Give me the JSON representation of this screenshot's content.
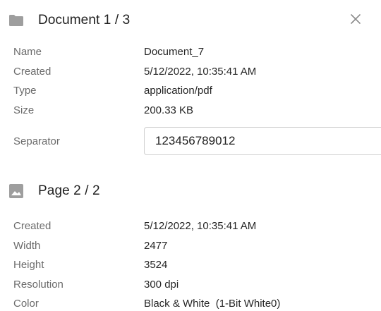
{
  "document_section": {
    "title": "Document 1 / 3",
    "icon": "folder-icon",
    "close_icon": "close-icon",
    "fields": [
      {
        "label": "Name",
        "value": "Document_7"
      },
      {
        "label": "Created",
        "value": "5/12/2022, 10:35:41 AM"
      },
      {
        "label": "Type",
        "value": "application/pdf"
      },
      {
        "label": "Size",
        "value": "200.33 KB"
      }
    ],
    "separator": {
      "label": "Separator",
      "value": "123456789012"
    }
  },
  "page_section": {
    "title": "Page 2 / 2",
    "icon": "image-icon",
    "fields": [
      {
        "label": "Created",
        "value": "5/12/2022, 10:35:41 AM"
      },
      {
        "label": "Width",
        "value": "2477"
      },
      {
        "label": "Height",
        "value": "3524"
      },
      {
        "label": "Resolution",
        "value": "300 dpi"
      },
      {
        "label": "Color",
        "value": "Black & White  (1-Bit White0)"
      }
    ]
  },
  "colors": {
    "icon_gray": "#9e9e9e",
    "label_gray": "#6b6b6b",
    "text": "#262626"
  }
}
